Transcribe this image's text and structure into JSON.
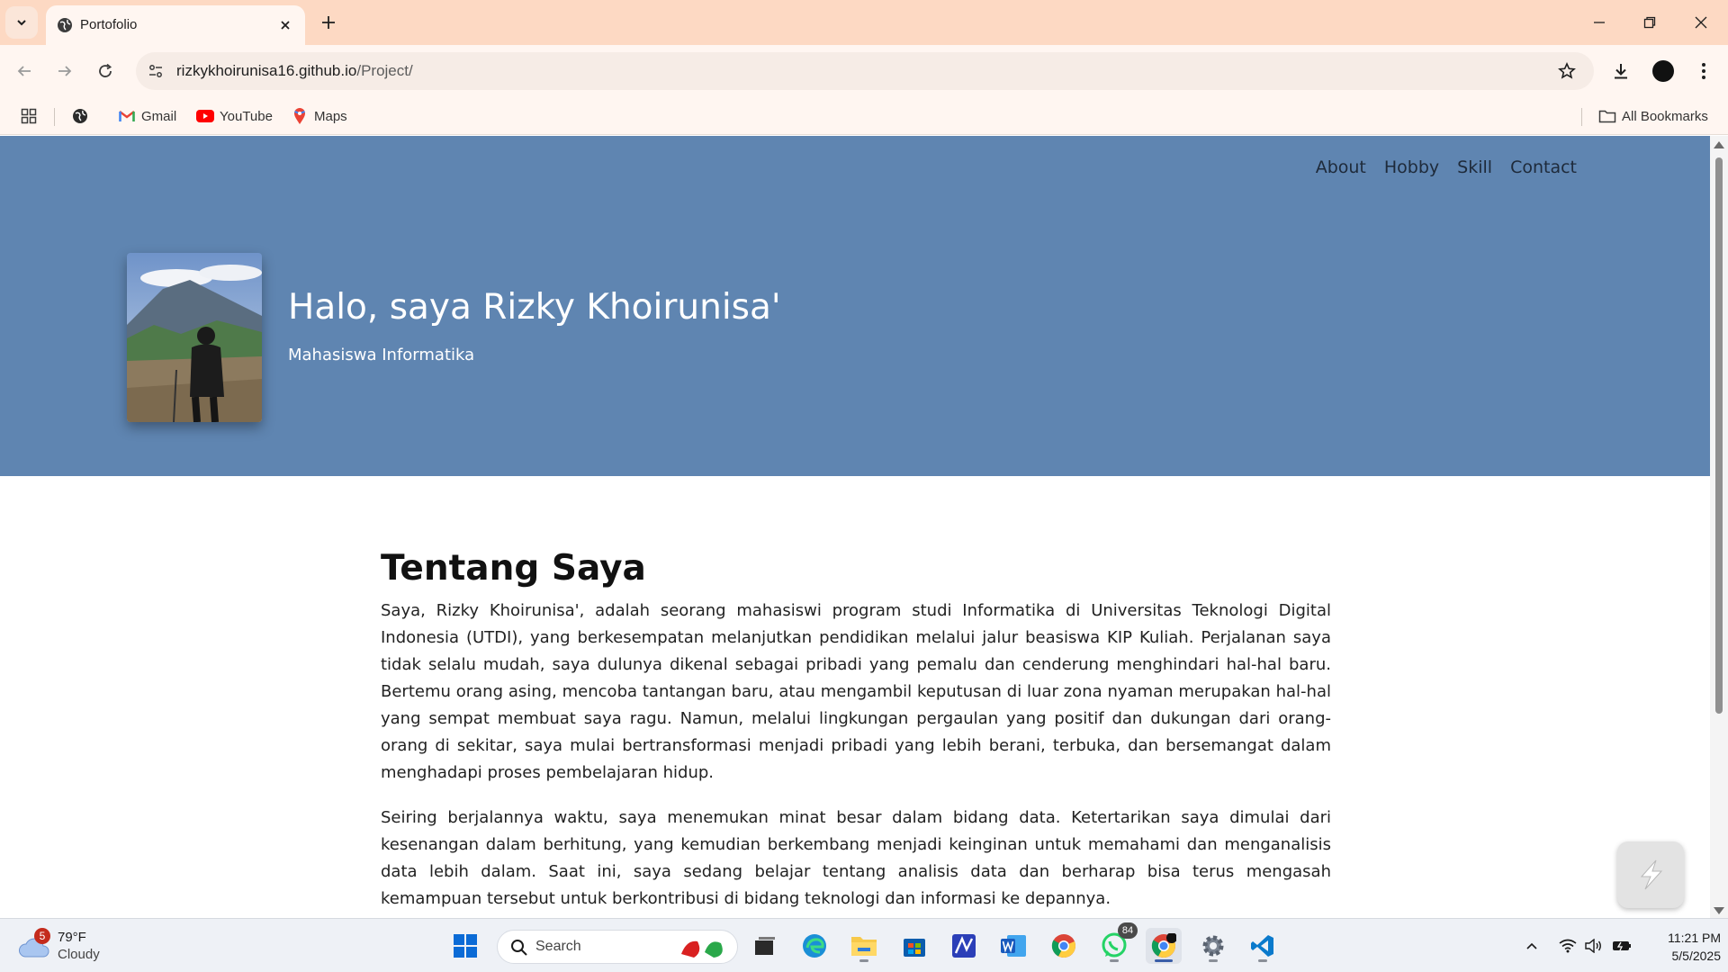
{
  "browser": {
    "tab_title": "Portofolio",
    "url_host": "rizkykhoirunisa16.github.io",
    "url_path": "/Project/",
    "bookmarks": [
      {
        "label": "Gmail",
        "icon": "gmail-icon"
      },
      {
        "label": "YouTube",
        "icon": "youtube-icon"
      },
      {
        "label": "Maps",
        "icon": "maps-icon"
      }
    ],
    "all_bookmarks_label": "All Bookmarks"
  },
  "site": {
    "nav": [
      "About",
      "Hobby",
      "Skill",
      "Contact"
    ],
    "hero_title": "Halo, saya Rizky Khoirunisa'",
    "hero_subtitle": "Mahasiswa Informatika",
    "hero_color": "#5f85b1",
    "about_heading": "Tentang Saya",
    "about_paragraphs": [
      "Saya, Rizky Khoirunisa', adalah seorang mahasiswi program studi Informatika di Universitas Teknologi Digital Indonesia (UTDI), yang berkesempatan melanjutkan pendidikan melalui jalur beasiswa KIP Kuliah. Perjalanan saya tidak selalu mudah, saya dulunya dikenal sebagai pribadi yang pemalu dan cenderung menghindari hal-hal baru. Bertemu orang asing, mencoba tantangan baru, atau mengambil keputusan di luar zona nyaman merupakan hal-hal yang sempat membuat saya ragu. Namun, melalui lingkungan pergaulan yang positif dan dukungan dari orang-orang di sekitar, saya mulai bertransformasi menjadi pribadi yang lebih berani, terbuka, dan bersemangat dalam menghadapi proses pembelajaran hidup.",
      "Seiring berjalannya waktu, saya menemukan minat besar dalam bidang data. Ketertarikan saya dimulai dari kesenangan dalam berhitung, yang kemudian berkembang menjadi keinginan untuk memahami dan menganalisis data lebih dalam. Saat ini, saya sedang belajar tentang analisis data dan berharap bisa terus mengasah kemampuan tersebut untuk berkontribusi di bidang teknologi dan informasi ke depannya."
    ]
  },
  "taskbar": {
    "weather_badge": "5",
    "weather_temp": "79°F",
    "weather_condition": "Cloudy",
    "search_label": "Search",
    "whatsapp_count": "84",
    "time": "11:21 PM",
    "date": "5/5/2025"
  }
}
